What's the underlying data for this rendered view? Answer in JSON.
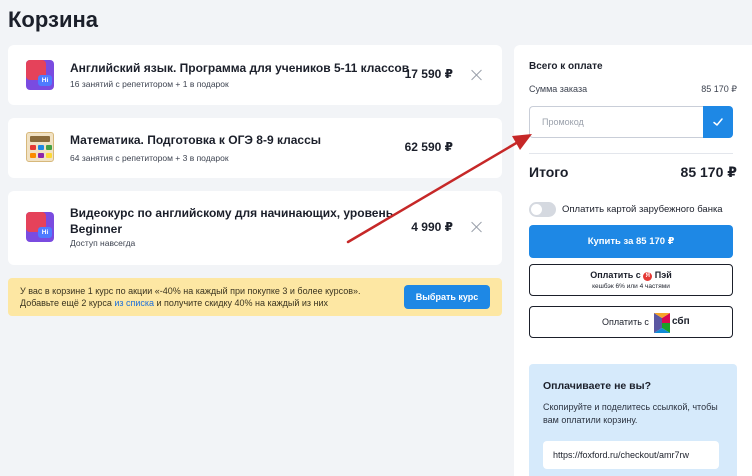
{
  "page": {
    "title": "Корзина"
  },
  "cart": {
    "items": [
      {
        "title": "Английский язык. Программа для учеников 5-11 классов",
        "title2": "",
        "subtitle": "16 занятий с репетитором + 1 в подарок",
        "price": "17 590 ₽",
        "icon": "english-course-icon"
      },
      {
        "title": "Математика. Подготовка к ОГЭ 8-9 классы",
        "title2": "",
        "subtitle": "64 занятия с репетитором + 3 в подарок",
        "price": "62 590 ₽",
        "icon": "calculator-icon"
      },
      {
        "title": "Видеокурс по английскому для начинающих, уровень",
        "title2": "Beginner",
        "subtitle": "Доступ навсегда",
        "price": "4 990 ₽",
        "icon": "english-course-icon"
      }
    ],
    "icon_badge": "Hi"
  },
  "promo_banner": {
    "line1": "У вас в корзине 1 курс по акции «-40% на каждый при покупке 3 и более курсов».",
    "line2_pre": "Добавьте ещё 2 курса ",
    "line2_link": "из списка",
    "line2_post": " и получите скидку  40% на каждый из них",
    "button": "Выбрать курс"
  },
  "summary": {
    "heading": "Всего к оплате",
    "order_label": "Сумма заказа",
    "order_value": "85 170 ₽",
    "promo_placeholder": "Промокод",
    "total_label": "Итого",
    "total_value": "85 170 ₽",
    "foreign_card_label": "Оплатить картой зарубежного банка",
    "buy_button": "Купить за  85 170 ₽",
    "pei_line1": "Оплатить с ",
    "pei_brand": "Пэй",
    "pei_logo": "Я",
    "pei_line2": "кешбэк 6% или 4 частями",
    "sbp_text": "Оплатить с",
    "sbp_brand": "сбп"
  },
  "share": {
    "heading": "Оплачиваете не вы?",
    "text": "Скопируйте и поделитесь ссылкой, чтобы вам оплатили корзину.",
    "link": "https://foxford.ru/checkout/amr7rw"
  },
  "colors": {
    "accent": "#1e88e5",
    "banner": "#fde7a3",
    "share_bg": "#d6eafb",
    "annotation_arrow": "#c62828"
  }
}
